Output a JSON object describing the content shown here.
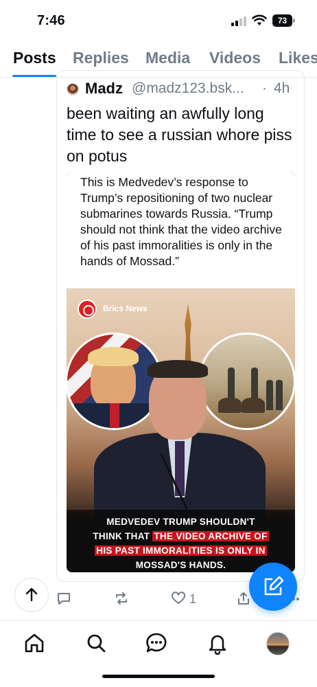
{
  "status_bar": {
    "time": "7:46",
    "battery": "73",
    "icons": [
      "signal-icon",
      "wifi-icon",
      "battery-icon"
    ]
  },
  "tabs": [
    {
      "label": "Posts",
      "active": true
    },
    {
      "label": "Replies",
      "active": false
    },
    {
      "label": "Media",
      "active": false
    },
    {
      "label": "Videos",
      "active": false
    },
    {
      "label": "Likes",
      "active": false
    }
  ],
  "post": {
    "author_name": "Madz",
    "author_handle": "@madz123.bsk...",
    "separator": "·",
    "time": "4h",
    "text": "been waiting an awfully long time to see a russian whore piss on potus",
    "embed": {
      "caption": "This is Medvedev’s response to Trump’s repositioning of two nuclear submarines towards Russia. “Trump should not think that the video archive of his past immoralities is only in the hands of Mossad.”",
      "source_label": "Brics News",
      "banner": {
        "line1": "MEDVEDEV TRUMP SHOULDN'T",
        "line2_plain": "THINK THAT ",
        "line2_highlight": "THE VIDEO ARCHIVE OF",
        "line3_highlight": "HIS PAST IMMORALITIES IS ONLY IN",
        "line4": "MOSSAD'S HANDS."
      }
    },
    "actions": {
      "reply_icon": "reply-icon",
      "repost_icon": "repost-icon",
      "like_icon": "heart-icon",
      "like_count": "1",
      "share_icon": "share-icon",
      "more_icon": "more-icon"
    }
  },
  "colors": {
    "accent": "#1083fe",
    "muted_text": "#6f7c89",
    "banner_highlight": "#c4161c"
  },
  "bottom_nav": [
    "home-icon",
    "search-icon",
    "chat-icon",
    "bell-icon",
    "profile-avatar"
  ]
}
